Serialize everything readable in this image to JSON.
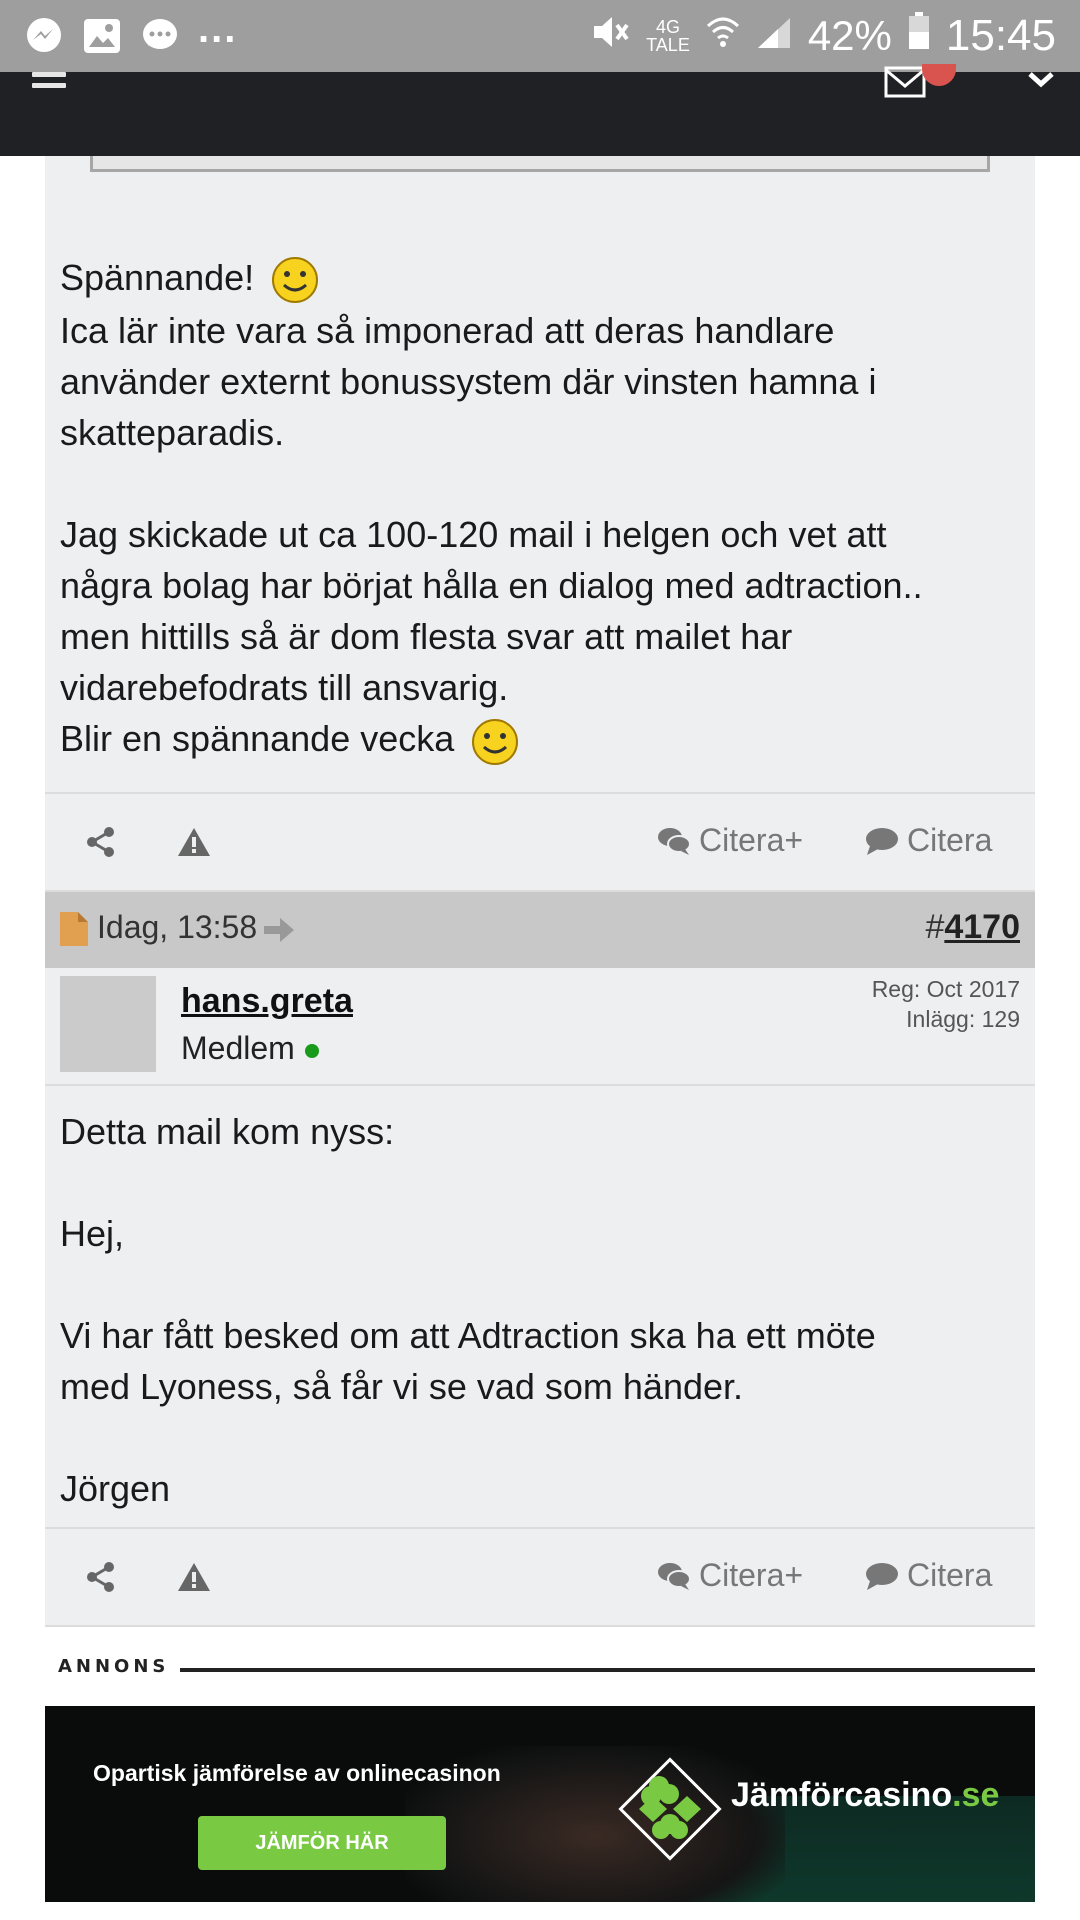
{
  "status_bar": {
    "network": "4G",
    "network_sub": "TALE",
    "battery": "42%",
    "time": "15:45"
  },
  "post1": {
    "paragraphs": [
      [
        "Spännande!"
      ],
      [
        "Ica lär inte vara så imponerad att deras handlare",
        "använder externt bonussystem där vinsten hamna i",
        "skatteparadis."
      ],
      [
        "Jag skickade ut ca 100-120 mail i helgen och vet att",
        "några bolag har börjat hålla en dialog med adtraction..",
        "men hittills så är dom flesta svar att mailet har",
        "vidarebefodrats till ansvarig."
      ],
      [
        "Blir en spännande vecka"
      ]
    ]
  },
  "actions": {
    "quote_plus": "Citera+",
    "quote": "Citera"
  },
  "post2": {
    "date": "Idag, 13:58",
    "number_prefix": "#",
    "number": "4170",
    "username": "hans.greta",
    "role": "Medlem",
    "reg": "Reg: Oct 2017",
    "posts": "Inlägg: 129",
    "lines": [
      "Detta mail kom nyss:",
      "",
      "Hej,",
      "",
      "Vi har fått besked om att Adtraction ska ha ett möte",
      "med Lyoness, så får vi se vad som händer.",
      "",
      "Jörgen"
    ]
  },
  "ad": {
    "label": "ANNONS",
    "headline": "Opartisk jämförelse av onlinecasinon",
    "button": "JÄMFÖR HÄR",
    "brand_main": "Jämförcasino",
    "brand_tld": ".se"
  },
  "colors": {
    "status_bar": "#9e9e9e",
    "app_bar": "#202124",
    "post_bg": "#eeeff1",
    "header_bg": "#c8c8c8",
    "ad_green": "#7ac943"
  }
}
